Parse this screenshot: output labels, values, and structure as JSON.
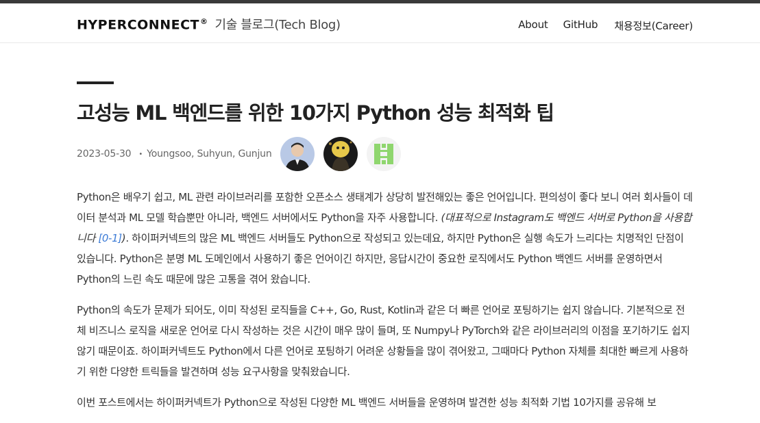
{
  "header": {
    "logo": "HYPERCONNECT",
    "logo_mark": "®",
    "blog_name": "기술 블로그(Tech Blog)",
    "nav": {
      "about": "About",
      "github": "GitHub",
      "career": "채용정보(Career)"
    }
  },
  "post": {
    "title": "고성능 ML 백엔드를 위한 10가지 Python 성능 최적화 팁",
    "date": "2023-05-30",
    "separator": "•",
    "authors": "Youngsoo, Suhyun, Gunjun"
  },
  "article": {
    "p1_a": "Python은 배우기 쉽고, ML 관련 라이브러리를 포함한 오픈소스 생태계가 상당히 발전해있는 좋은 언어입니다. 편의성이 좋다 보니 여러 회사들이 데이터 분석과 ML 모델 학습뿐만 아니라, 백엔드 서버에서도 Python을 자주 사용합니다. ",
    "p1_em": "(대표적으로 Instagram도 백엔드 서버로 Python을 사용합니다 ",
    "p1_link": "[0-1]",
    "p1_em_end": ")",
    "p1_b": ". 하이퍼커넥트의 많은 ML 백엔드 서버들도 Python으로 작성되고 있는데요, 하지만 Python은 실행 속도가 느리다는 치명적인 단점이 있습니다. Python은 분명 ML 도메인에서 사용하기 좋은 언어이긴 하지만, 응답시간이 중요한 로직에서도 Python 백엔드 서버를 운영하면서 Python의 느린 속도 때문에 많은 고통을 겪어 왔습니다.",
    "p2": "Python의 속도가 문제가 되어도, 이미 작성된 로직들을 C++, Go, Rust, Kotlin과 같은 더 빠른 언어로 포팅하기는 쉽지 않습니다. 기본적으로 전체 비즈니스 로직을 새로운 언어로 다시 작성하는 것은 시간이 매우 많이 들며, 또 Numpy나 PyTorch와 같은 라이브러리의 이점을 포기하기도 쉽지 않기 때문이죠. 하이퍼커넥트도 Python에서 다른 언어로 포팅하기 어려운 상황들을 많이 겪어왔고, 그때마다 Python 자체를 최대한 빠르게 사용하기 위한 다양한 트릭들을 발견하며 성능 요구사항을 맞춰왔습니다.",
    "p3": "이번 포스트에서는 하이퍼커넥트가 Python으로 작성된 다양한 ML 백엔드 서버들을 운영하며 발견한 성능 최적화 기법 10가지를 공유해 보"
  },
  "colors": {
    "topbar": "#3a3a3a",
    "link": "#3c7bd6",
    "text": "#333333"
  },
  "icons": {
    "avatar_1": "author-photo-youngsoo",
    "avatar_2": "author-photo-suhyun",
    "avatar_3": "author-identicon-gunjun"
  }
}
